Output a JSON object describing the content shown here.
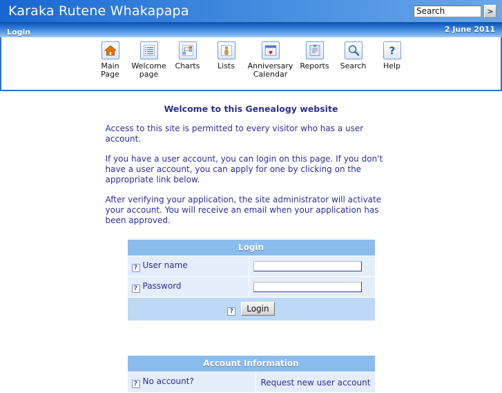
{
  "header": {
    "site_title": "Karaka Rutene Whakapapa",
    "search_value": "Search",
    "search_placeholder": "Search",
    "search_button_label": ">"
  },
  "namebar": {
    "page_name": "Login",
    "date": "2 June 2011"
  },
  "toolbar": {
    "items": [
      {
        "label": "Main Page",
        "icon": "home-icon"
      },
      {
        "label": "Welcome page",
        "icon": "list-lines-icon"
      },
      {
        "label": "Charts",
        "icon": "chart-tree-icon"
      },
      {
        "label": "Lists",
        "icon": "person-icon"
      },
      {
        "label": "Anniversary Calendar",
        "icon": "calendar-heart-icon"
      },
      {
        "label": "Reports",
        "icon": "clipboard-icon"
      },
      {
        "label": "Search",
        "icon": "magnifier-icon"
      },
      {
        "label": "Help",
        "icon": "question-icon"
      }
    ]
  },
  "content": {
    "heading": "Welcome to this Genealogy website",
    "paragraphs": [
      "Access to this site is permitted to every visitor who has a user account.",
      "If you have a user account, you can login on this page. If you don't have a user account, you can apply for one by clicking on the appropriate link below.",
      "After verifying your application, the site administrator will activate your account. You will receive an email when your application has been approved."
    ]
  },
  "login_panel": {
    "title": "Login",
    "help_glyph": "?",
    "username_label": "User name",
    "username_value": "",
    "password_label": "Password",
    "password_value": "",
    "submit_label": "Login"
  },
  "account_panel": {
    "title": "Account Information",
    "help_glyph": "?",
    "no_account_label": "No account?",
    "request_link_label": "Request new user account"
  },
  "colors": {
    "header_blue_dark": "#1666d0",
    "header_blue_light": "#6aa6e8",
    "panel_header_blue": "#8bbcee",
    "panel_cell_blue": "#e4eefb",
    "text_navy": "#2b2f8f",
    "toolbar_border": "#2f6fd0"
  }
}
